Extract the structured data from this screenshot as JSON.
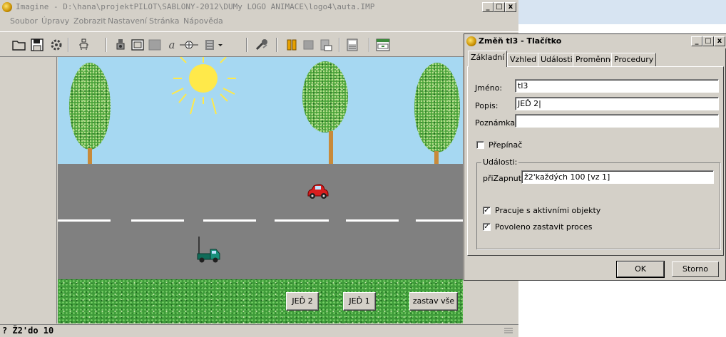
{
  "main_window": {
    "title": "Imagine - D:\\hana\\projektPILOT\\SABLONY-2012\\DUMy LOGO ANIMACE\\logo4\\auta.IMP",
    "caption_buttons": {
      "minimize": "_",
      "maximize": "□",
      "close": "x"
    },
    "menu": [
      "Soubor",
      "Úpravy",
      "Zobrazit",
      "Nastavení",
      "Stránka",
      "Nápověda"
    ],
    "toolbar_icons": [
      "open-folder-icon",
      "save-disk-icon",
      "settings-icon",
      "turtle-new-icon",
      "turtle-icon",
      "button-icon",
      "rectangle-icon",
      "text-icon",
      "slider-icon",
      "dropdown-icon",
      "tools-icon",
      "pause-icon",
      "stop-icon",
      "run-icon",
      "page-icon",
      "page-setup-icon"
    ],
    "scene_buttons": {
      "jed2": "JEĎ 2",
      "jed1": "JEĎ 1",
      "stop_all": "zastav vše"
    },
    "status_text": "? Ž2'do 10"
  },
  "dialog": {
    "title": "Změň tl3  - Tlačítko",
    "caption_buttons": {
      "minimize": "_",
      "maximize": "□",
      "close": "x"
    },
    "tabs": [
      "Základní",
      "Vzhled",
      "Události",
      "Proměnné",
      "Procedury"
    ],
    "active_tab": "Základní",
    "fields": {
      "name_label": "Jméno:",
      "name_value": "tl3",
      "description_label": "Popis:",
      "description_value": "JEĎ 2|",
      "note_label": "Poznámka:",
      "note_value": ""
    },
    "toggle_checkbox": {
      "label": "Přepínač",
      "checked": false
    },
    "events_group": {
      "title": "Události:",
      "on_label": "přiZapnutí:",
      "on_value": "ž2'každých 100 [vz 1]"
    },
    "options": [
      {
        "label": "Pracuje s aktivními objekty",
        "checked": true
      },
      {
        "label": "Povoleno zastavit proces",
        "checked": true
      }
    ],
    "ok_label": "OK",
    "cancel_label": "Storno"
  },
  "colors": {
    "sky": "#a6d8f2",
    "road": "#808080",
    "grass": "#3f9c3a",
    "sun": "#ffe94a",
    "red_car": "#d81e1e",
    "truck": "#18907a",
    "window_bg": "#d4d0c8"
  }
}
